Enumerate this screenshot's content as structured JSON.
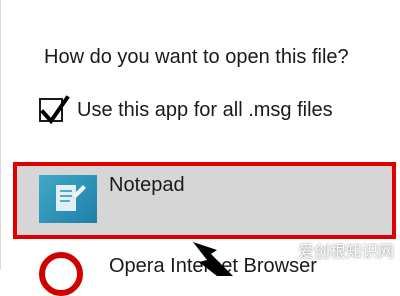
{
  "dialog": {
    "question": "How do you want to open this file?",
    "checkbox_label": "Use this app for all .msg files",
    "checkbox_checked": true
  },
  "apps": [
    {
      "name": "Notepad",
      "icon": "notepad-icon",
      "selected": true
    },
    {
      "name": "Opera Internet Browser",
      "icon": "opera-icon",
      "selected": false
    }
  ],
  "highlight": {
    "color": "#e00000"
  },
  "watermark": "爱创根知识网"
}
